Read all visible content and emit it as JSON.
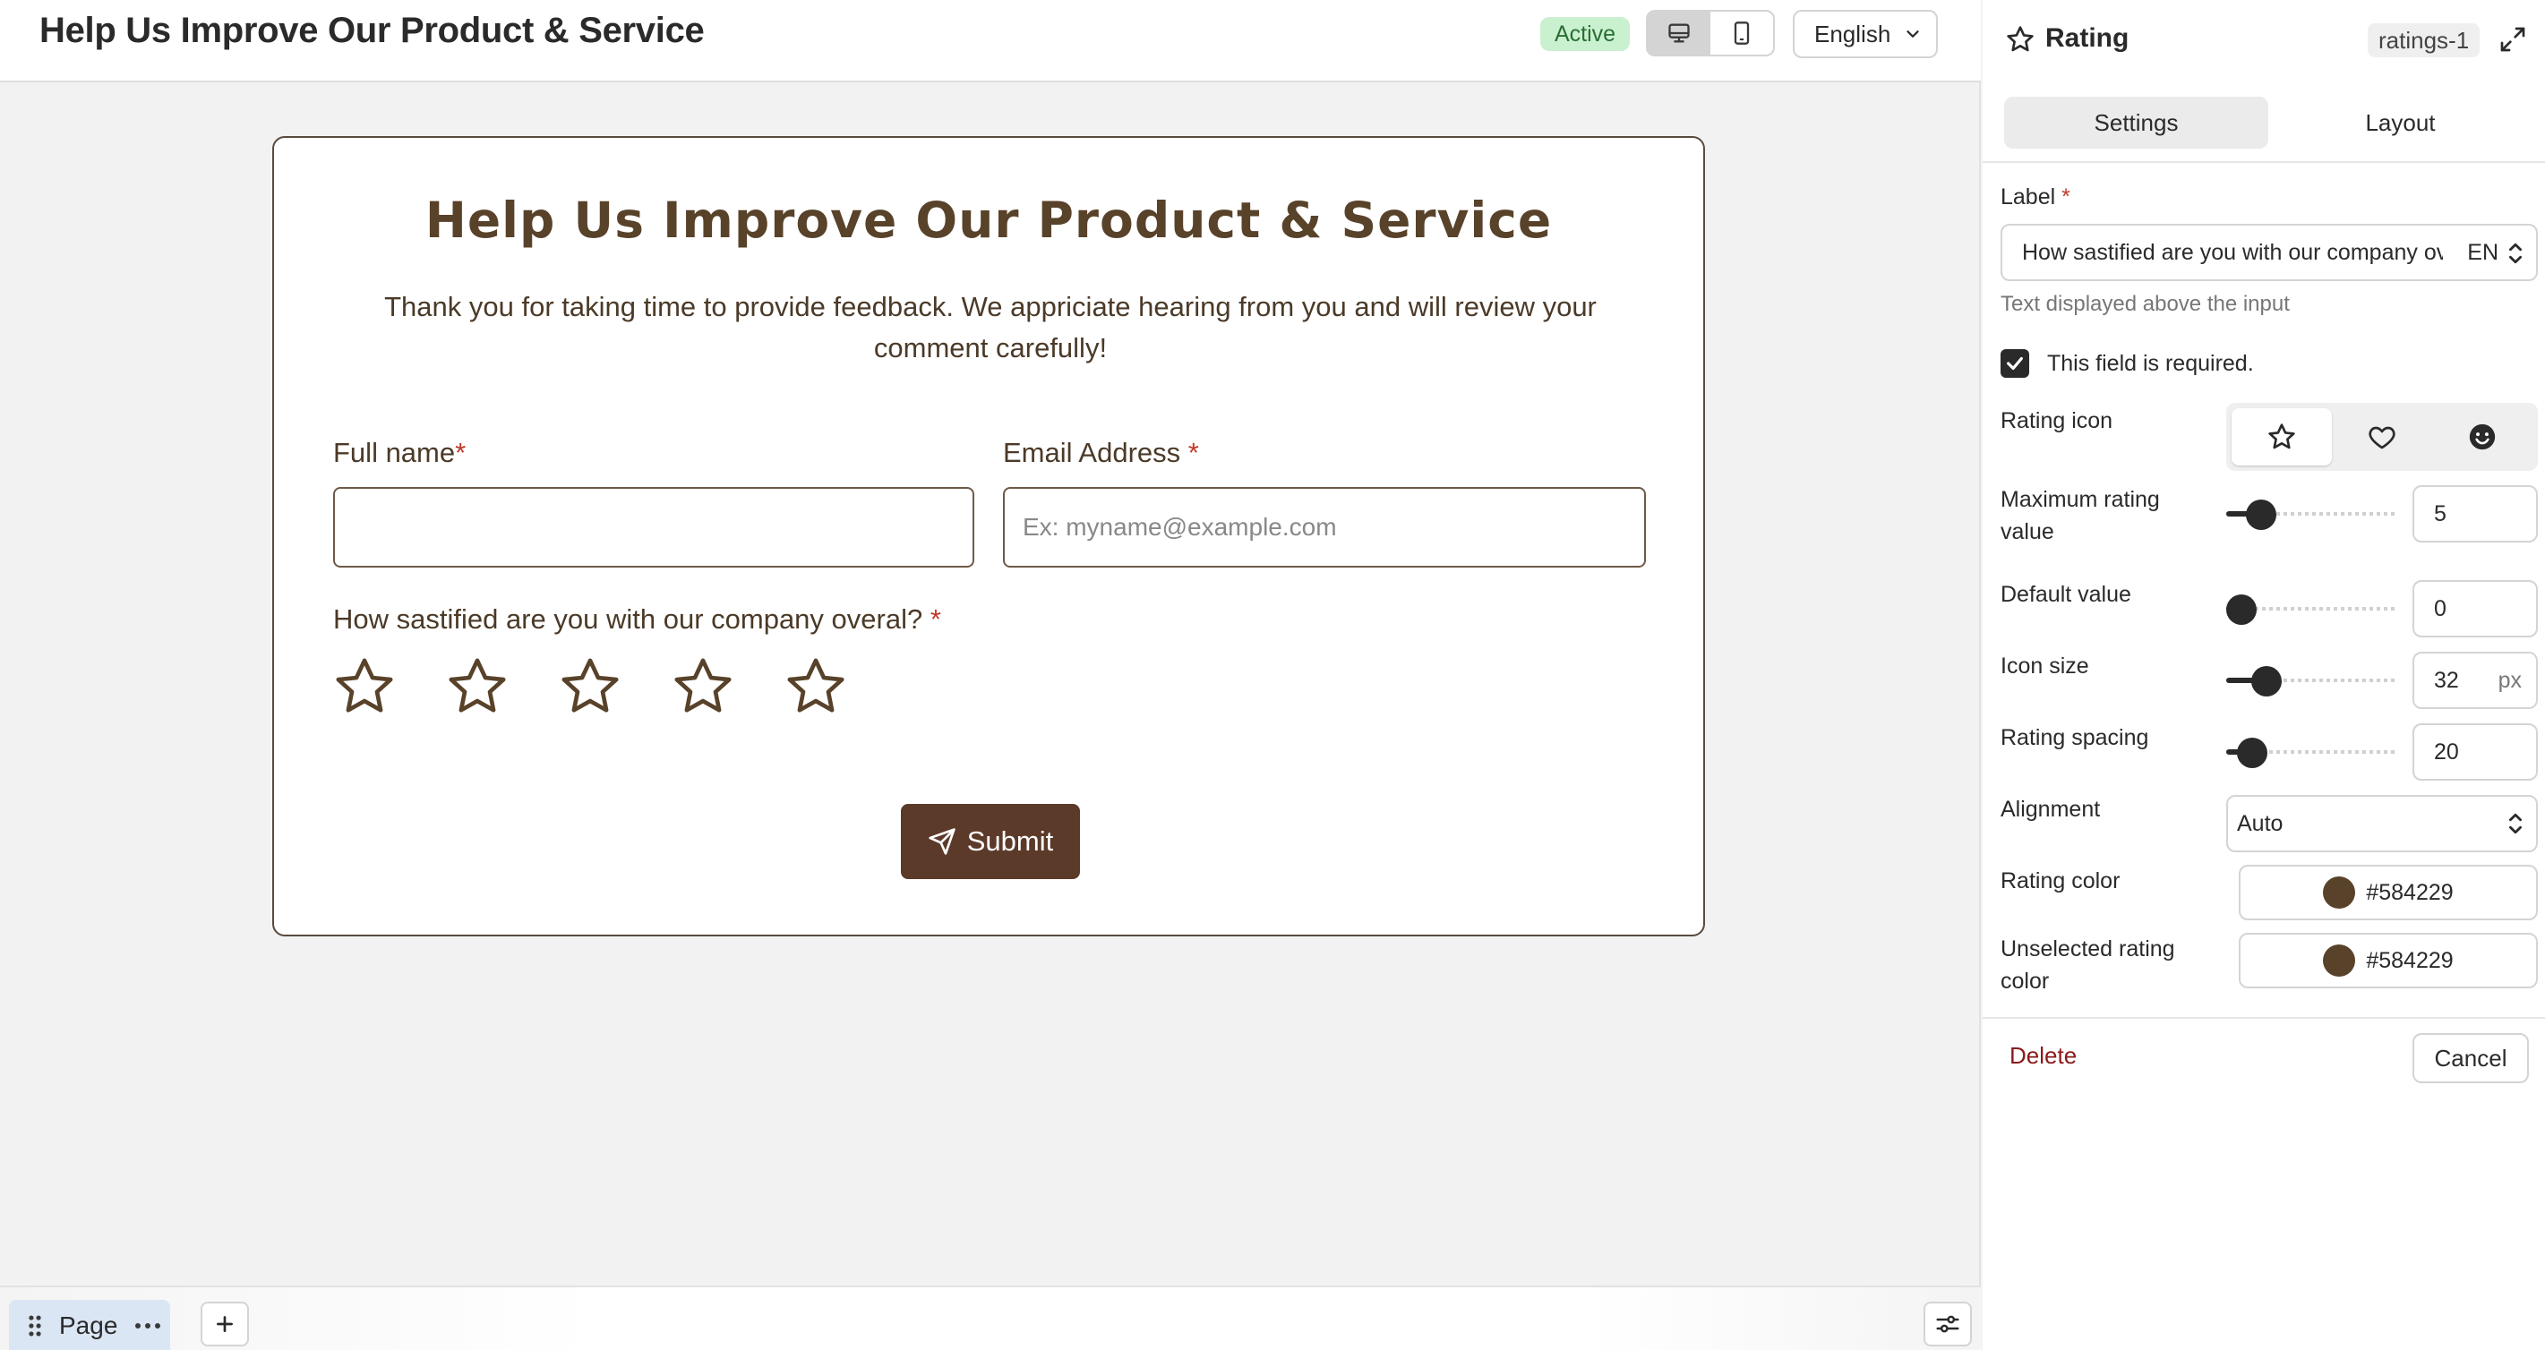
{
  "topbar": {
    "title": "Help Us Improve Our Product & Service",
    "status": "Active",
    "language": "English",
    "status_color": "#c9f0cf"
  },
  "form": {
    "title": "Help Us Improve Our Product & Service",
    "description": "Thank you for taking time to provide feedback. We appriciate hearing from you and will review your comment carefully!",
    "fields": {
      "full_name_label": "Full name",
      "email_label": "Email Address",
      "email_placeholder": "Ex: myname@example.com",
      "rating_label": "How sastified are you with our company overal?",
      "required_marker": "*"
    },
    "rating": {
      "max": 5,
      "value": 0,
      "icon": "star-icon",
      "color": "#584229"
    },
    "submit_label": "Submit",
    "submit_color": "#5c3a2a",
    "title_color": "#584229"
  },
  "bottom_bar": {
    "page_tab_label": "Page"
  },
  "panel": {
    "title": "Rating",
    "element_id": "ratings-1",
    "tabs": [
      {
        "label": "Settings",
        "active": true
      },
      {
        "label": "Layout",
        "active": false
      }
    ],
    "label_field": {
      "label": "Label",
      "required_marker": "*",
      "value": "How sastified are you with our company overal?",
      "lang": "EN",
      "help": "Text displayed above the input"
    },
    "required_checkbox": {
      "label": "This field is required.",
      "checked": true
    },
    "rating_icon": {
      "label": "Rating icon",
      "options": [
        "star-icon",
        "heart-icon",
        "smiley-icon"
      ],
      "selected": "star-icon"
    },
    "max_rating": {
      "label": "Maximum rating value",
      "value": "5",
      "fraction": 0.14
    },
    "default_value": {
      "label": "Default value",
      "value": "0",
      "fraction": 0.0
    },
    "icon_size": {
      "label": "Icon size",
      "value": "32",
      "unit": "px",
      "fraction": 0.18
    },
    "rating_spacing": {
      "label": "Rating spacing",
      "value": "20",
      "fraction": 0.08
    },
    "alignment": {
      "label": "Alignment",
      "value": "Auto"
    },
    "rating_color": {
      "label": "Rating color",
      "value": "#584229"
    },
    "unselected_color": {
      "label": "Unselected rating color",
      "value": "#584229"
    },
    "delete_label": "Delete",
    "cancel_label": "Cancel"
  }
}
